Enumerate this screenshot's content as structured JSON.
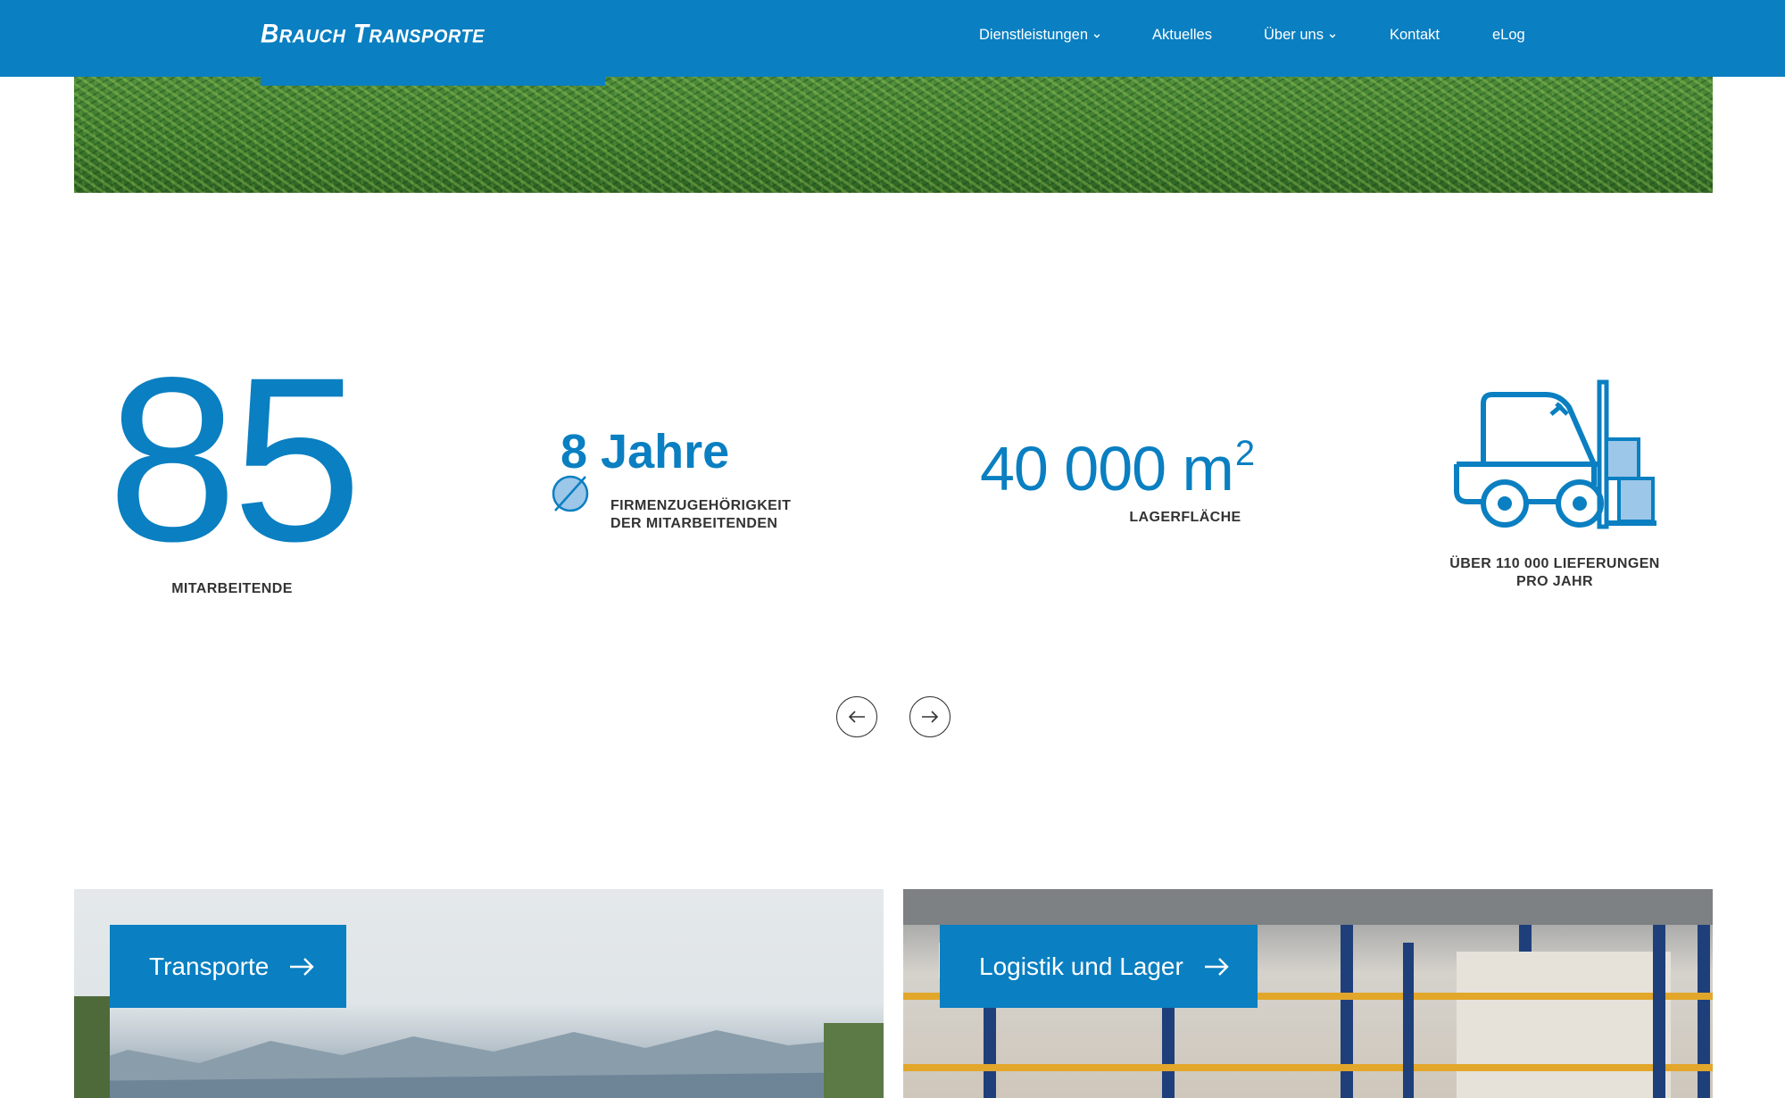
{
  "brand": {
    "logo_text": "Brauch Transporte",
    "accent_color": "#0a7fc1"
  },
  "nav": {
    "items": [
      {
        "label": "Dienstleistungen",
        "has_dropdown": true
      },
      {
        "label": "Aktuelles",
        "has_dropdown": false
      },
      {
        "label": "Über uns",
        "has_dropdown": true
      },
      {
        "label": "Kontakt",
        "has_dropdown": false
      },
      {
        "label": "eLog",
        "has_dropdown": false
      }
    ]
  },
  "stats": {
    "employees": {
      "value": "85",
      "label": "MITARBEITENDE"
    },
    "tenure": {
      "value": "8 Jahre",
      "label_line1": "FIRMENZUGEHÖRIGKEIT",
      "label_line2": "DER MITARBEITENDEN",
      "icon": "average-diameter-icon"
    },
    "storage": {
      "value": "40 000 m",
      "unit_exp": "2",
      "label": "LAGERFLÄCHE"
    },
    "deliveries": {
      "label_line1": "ÜBER 110 000 LIEFERUNGEN",
      "label_line2": "PRO JAHR",
      "icon": "forklift-icon"
    }
  },
  "slider": {
    "prev_icon": "arrow-left-icon",
    "next_icon": "arrow-right-icon"
  },
  "cards": [
    {
      "label": "Transporte",
      "icon": "arrow-right-icon"
    },
    {
      "label": "Logistik und Lager",
      "icon": "arrow-right-icon"
    }
  ]
}
